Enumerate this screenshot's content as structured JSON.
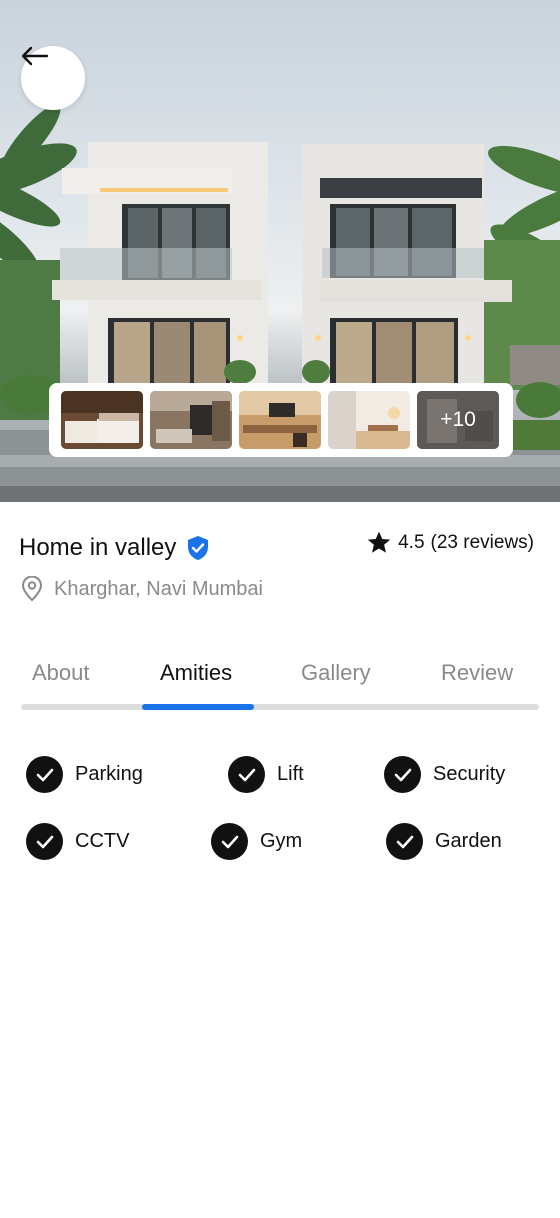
{
  "header": {
    "back_icon": "arrow-left-icon",
    "gallery_more_label": "+10"
  },
  "property": {
    "title": "Home in valley",
    "verified_icon": "verified-shield-icon",
    "rating_value": "4.5",
    "reviews_label": "(23 reviews)",
    "location": "Kharghar, Navi Mumbai"
  },
  "tabs": [
    {
      "label": "About",
      "active": false
    },
    {
      "label": "Amities",
      "active": true
    },
    {
      "label": "Gallery",
      "active": false
    },
    {
      "label": "Review",
      "active": false
    }
  ],
  "amenities": [
    {
      "label": "Parking",
      "icon": "check-circle-icon"
    },
    {
      "label": "Lift",
      "icon": "check-circle-icon"
    },
    {
      "label": "Security",
      "icon": "check-circle-icon"
    },
    {
      "label": "CCTV",
      "icon": "check-circle-icon"
    },
    {
      "label": "Gym",
      "icon": "check-circle-icon"
    },
    {
      "label": "Garden",
      "icon": "check-circle-icon"
    }
  ],
  "colors": {
    "accent": "#1a73e8",
    "text": "#111111",
    "muted": "#8a8a8a"
  }
}
